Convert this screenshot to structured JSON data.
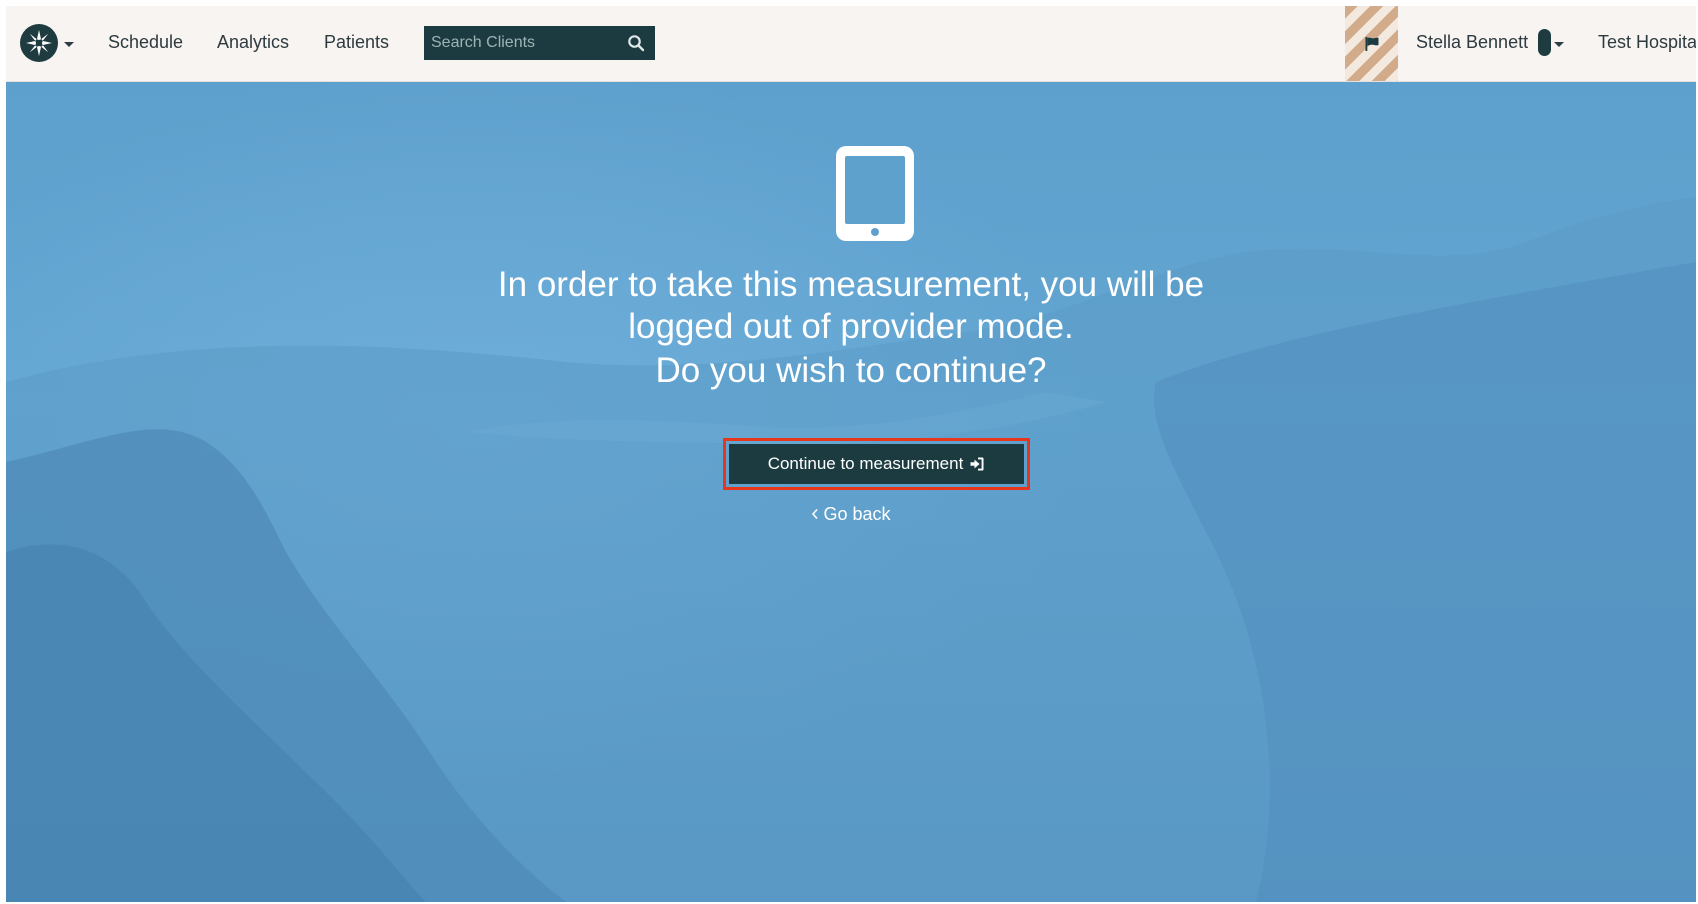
{
  "nav": {
    "schedule": "Schedule",
    "analytics": "Analytics",
    "patients": "Patients"
  },
  "search": {
    "placeholder": "Search Clients",
    "value": ""
  },
  "user": {
    "name": "Stella Bennett",
    "organization": "Test Hospital"
  },
  "dialog": {
    "message_line1": "In order to take this measurement, you will be",
    "message_line2": "logged out of provider mode.",
    "question": "Do you wish to continue?",
    "continue_label": "Continue to measurement",
    "go_back_label": "Go back"
  },
  "icons": {
    "logo": "compass-star-icon",
    "search": "search-icon",
    "flag": "flag-icon",
    "device": "tablet-icon",
    "continue": "sign-in-icon",
    "back": "chevron-left-icon"
  },
  "colors": {
    "nav_background": "#f7f4f1",
    "brand_dark": "#1c3b40",
    "hero_blue": "#5ea0cd",
    "highlight_red": "#e8361c",
    "text_white": "#ffffff"
  }
}
